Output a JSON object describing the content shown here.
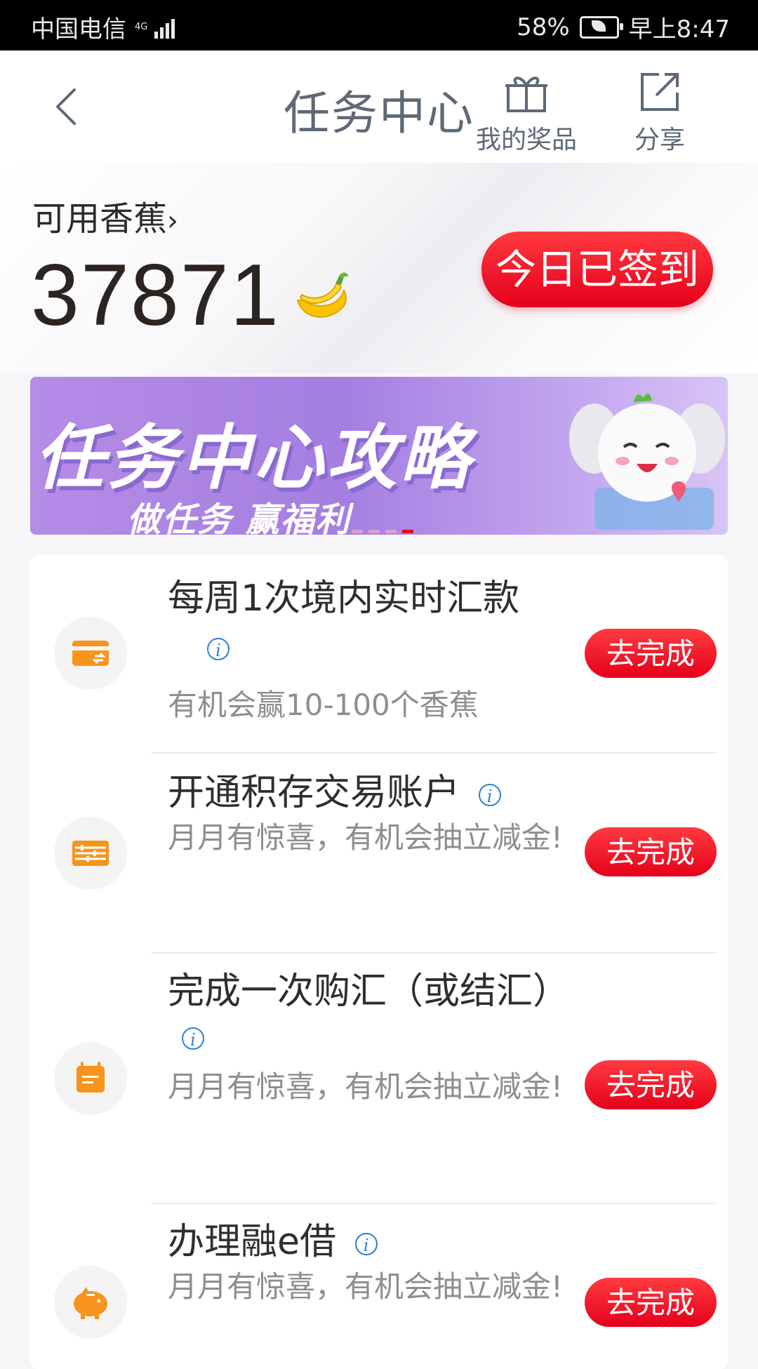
{
  "status_bar": {
    "carrier": "中国电信",
    "network": "4G",
    "battery": "58%",
    "time": "早上8:47"
  },
  "header": {
    "title": "任务中心",
    "prizes_label": "我的奖品",
    "share_label": "分享"
  },
  "balance": {
    "label": "可用香蕉",
    "value": "37871",
    "checkin_label": "今日已签到"
  },
  "banner": {
    "title": "任务中心攻略",
    "subtitle": "做任务 赢福利"
  },
  "tasks": [
    {
      "name": "每周1次境内实时汇款",
      "desc": "有机会赢10-100个香蕉",
      "action": "去完成",
      "icon": "transfer-card-icon"
    },
    {
      "name": "开通积存交易账户",
      "desc": "月月有惊喜，有机会抽立减金!",
      "action": "去完成",
      "icon": "abacus-icon"
    },
    {
      "name": "完成一次购汇（或结汇）",
      "desc": "月月有惊喜，有机会抽立减金!",
      "action": "去完成",
      "icon": "calendar-icon"
    },
    {
      "name": "办理融e借",
      "desc": "月月有惊喜，有机会抽立减金!",
      "action": "去完成",
      "icon": "piggy-bank-icon"
    }
  ],
  "colors": {
    "accent": "#e5001b",
    "icon_orange": "#f7941d",
    "header_text": "#5d6976"
  }
}
